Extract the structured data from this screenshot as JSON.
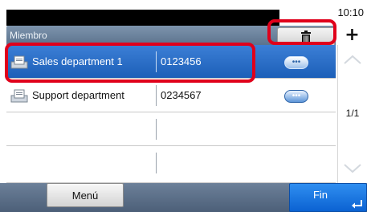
{
  "status": {
    "time": "10:10"
  },
  "header": {
    "title": "Miembro"
  },
  "toolbar": {
    "delete_icon": "trash-icon",
    "add_icon": "plus-icon",
    "add_glyph": "+"
  },
  "list": {
    "rows": [
      {
        "name": "Sales department 1",
        "number": "0123456",
        "selected": true,
        "icon": "document-tray-icon"
      },
      {
        "name": "Support department",
        "number": "0234567",
        "selected": false,
        "icon": "document-tray-icon"
      },
      {
        "name": "",
        "number": "",
        "selected": false
      },
      {
        "name": "",
        "number": "",
        "selected": false
      }
    ]
  },
  "scroll": {
    "page_indicator": "1/1"
  },
  "bottom": {
    "menu_label": "Menú",
    "fin_label": "Fin"
  },
  "colors": {
    "callout": "#e0001b",
    "selected_row": "#1c5fb8",
    "header": "#6c8099",
    "fin_button": "#0b62d2"
  }
}
